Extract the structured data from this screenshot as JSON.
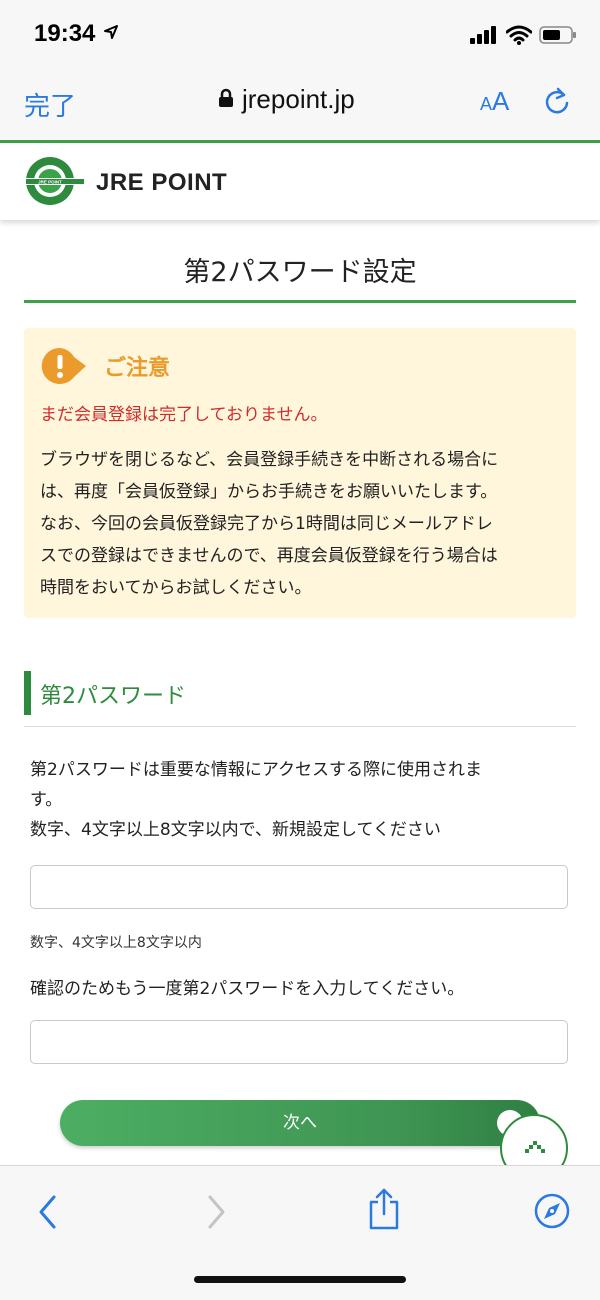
{
  "status_bar": {
    "time": "19:34"
  },
  "browser": {
    "done_label": "完了",
    "url": "jrepoint.jp",
    "text_size_small": "A",
    "text_size_large": "A"
  },
  "site": {
    "brand": "JRE POINT",
    "logo_text": "JRE POINT"
  },
  "page": {
    "title": "第2パスワード設定"
  },
  "notice": {
    "heading": "ご注意",
    "warning": "まだ会員登録は完了しておりません。",
    "lines": [
      "ブラウザを閉じるなど、会員登録手続きを中断される場合に",
      "は、再度「会員仮登録」からお手続きをお願いいたします。",
      "なお、今回の会員仮登録完了から1時間は同じメールアドレ",
      "スでの登録はできませんので、再度会員仮登録を行う場合は",
      "時間をおいてからお試しください。"
    ]
  },
  "section": {
    "title": "第2パスワード",
    "desc_lines": [
      "第2パスワードは重要な情報にアクセスする際に使用されま",
      "す。",
      "数字、4文字以上8文字以内で、新規設定してください"
    ],
    "hint": "数字、4文字以上8文字以内",
    "confirm_label": "確認のためもう一度第2パスワードを入力してください。",
    "password_value": "",
    "confirm_value": ""
  },
  "next_button": {
    "label": "次へ"
  },
  "colors": {
    "accent_green": "#2e8b3e",
    "notice_bg": "#fff6dc",
    "warning_red": "#d02c2c",
    "ios_blue": "#2a7ae2",
    "notice_orange": "#eb9b2b"
  },
  "icons": [
    "location-arrow-icon",
    "signal-icon",
    "wifi-icon",
    "battery-icon",
    "lock-icon",
    "reload-icon",
    "exclamation-icon",
    "back-icon",
    "forward-icon",
    "share-icon",
    "compass-icon",
    "chevron-up-icon",
    "check-icon"
  ]
}
